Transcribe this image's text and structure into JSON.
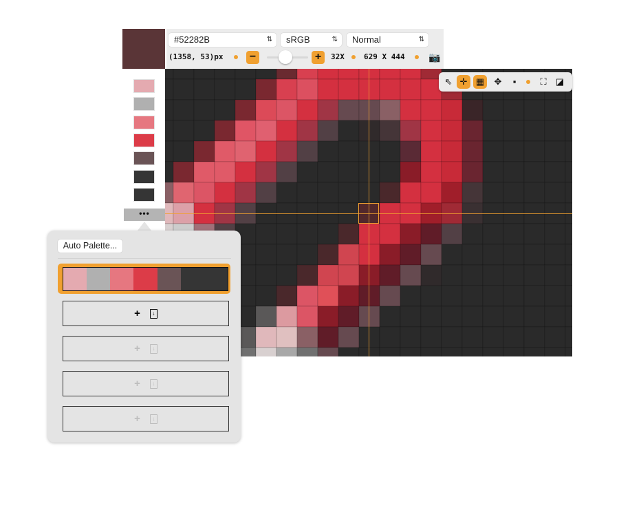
{
  "current_color": "#52282B",
  "toolbar": {
    "hex_value": "#52282B",
    "color_space": "sRGB",
    "blend_mode": "Normal",
    "chevron": "⌃⌄",
    "coords": "(1358, 53)px",
    "zoom_out": "−",
    "zoom_in": "+",
    "zoom_level": "32X",
    "zoom_fraction": 0.45,
    "dimensions": "629 X 444",
    "camera_icon": "camera-icon"
  },
  "tools": [
    {
      "name": "pointer-icon",
      "glyph": "⇖",
      "active": false
    },
    {
      "name": "crosshair-icon",
      "glyph": "✛",
      "active": true
    },
    {
      "name": "grid-icon",
      "glyph": "▦",
      "active": true
    },
    {
      "name": "move-icon",
      "glyph": "✥",
      "active": false
    },
    {
      "name": "tiles-icon",
      "glyph": "▪",
      "active": false
    },
    {
      "name": "frame-icon",
      "glyph": "⛶",
      "active": false
    },
    {
      "name": "layers-icon",
      "glyph": "◪",
      "active": false
    }
  ],
  "sidebar": {
    "swatches": [
      "#e4aab0",
      "#b0b0b0",
      "#e67780",
      "#dc3c48",
      "#6a5456",
      "#353535",
      "#353535"
    ],
    "more_label": "•••"
  },
  "popover": {
    "auto_palette_label": "Auto Palette...",
    "selected_palette": [
      "#e4aab0",
      "#b0b0b0",
      "#e67780",
      "#dc3c48",
      "#6a5456",
      "#353535",
      "#353535"
    ],
    "slots": [
      {
        "plus": "+",
        "doc": "↓",
        "enabled": true
      },
      {
        "plus": "+",
        "doc": "↓",
        "enabled": false
      },
      {
        "plus": "+",
        "doc": "↓",
        "enabled": false
      },
      {
        "plus": "+",
        "doc": "↓",
        "enabled": false
      }
    ]
  },
  "accent_color": "#f0a030",
  "pixel_grid": {
    "codes": {
      "D": "#2a2a2a",
      "a": "#302a2b",
      "M": "#7a2830",
      "m": "#6a2a30",
      "R": "#d43040",
      "r": "#d84050",
      "s": "#dc5060",
      "t": "#dc4a58",
      "u": "#dc5565",
      "v": "#e05565",
      "w": "#e06070",
      "x": "#e05a68",
      "y": "#e06370",
      "z": "#e06570",
      "B": "#a03545",
      "g": "#664a50",
      "G": "#524045",
      "p": "#8a6065",
      "q": "#e0b8bb",
      "Q": "#dca0a8",
      "W": "#d8d0d0",
      "C": "#cccccc",
      "o": "#a07078",
      "e": "#4a282b",
      "f": "#d04550",
      "F": "#8a1c28",
      "h": "#601c28",
      "n": "#5a5858",
      "N": "#707070",
      "i": "#e0c0c0",
      "j": "#a8a8a8",
      "k": "#a02a35",
      "K": "#c82a38",
      "l": "#3a2528",
      "L": "#6a2530",
      "S": "#453538",
      "T": "#5a2a35",
      "U": "#a01e2a",
      "V": "#3a3032",
      "X": "#52282b",
      "Y": "#dc9aa0",
      "Z": "#e05058"
    },
    "rows": [
      "DDDDDDmrRRRRRkDDDDDDD",
      "DDDDDMrsRRRRRRkDDDDDD",
      "DDDDMtuRBggpRRKlDDDDD",
      "DDDMvwRBGDaSBRKLDDDDD",
      "DDMxyRBGDDDDTRKLDDDDD",
      "DMxxRBGDDDDDFRKLDDDDD",
      "pzuRBGDDDDDeRRUSDDDDD",
      "qQRBGDDDDDXRRUkVDDDDD",
      "WCoGDDDDDeRRFhGDDDDDD",
      "DDDDDDDDefRFhgDDDDDDD",
      "DDDDDDDeffFhgaDDDDDDD",
      "DDDDDDeuZFhgDDDDDDDDD",
      "DDDDDnYuFhgDDDDDDDDDD",
      "DDDDnqiphgDDDDDDDDDDD",
      "DDDDNWjNgDDDDDDDDDDDD"
    ]
  }
}
